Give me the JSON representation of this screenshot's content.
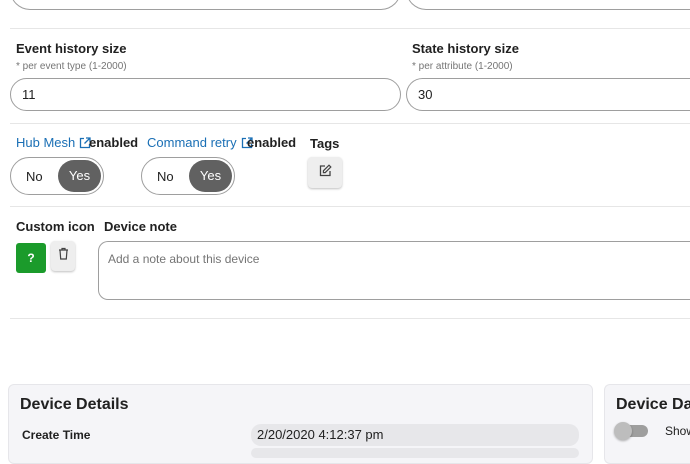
{
  "history": {
    "event_label": "Event history size",
    "event_hint": "* per event type (1-2000)",
    "event_value": "11",
    "state_label": "State history size",
    "state_hint": "* per attribute (1-2000)",
    "state_value": "30"
  },
  "toggles": {
    "hub_mesh_link": "Hub Mesh",
    "hub_mesh_status": "enabled",
    "hub_mesh_no": "No",
    "hub_mesh_yes": "Yes",
    "command_retry_link": "Command retry",
    "command_retry_status": "enabled",
    "command_retry_no": "No",
    "command_retry_yes": "Yes",
    "tags_label": "Tags"
  },
  "custom": {
    "icon_label": "Custom icon",
    "icon_button": "?",
    "note_label": "Device note",
    "note_placeholder": "Add a note about this device"
  },
  "details": {
    "title": "Device Details",
    "create_time_label": "Create Time",
    "create_time_value": "2/20/2020 4:12:37 pm"
  },
  "data_card": {
    "title": "Device Data",
    "switch_label": "Show"
  },
  "colors": {
    "link": "#1a6fb5",
    "toggle_on": "#616161",
    "icon_button": "#1b9b2b"
  },
  "icons": {
    "external_link": "external-link-icon",
    "edit": "edit-icon",
    "trash": "trash-icon"
  }
}
